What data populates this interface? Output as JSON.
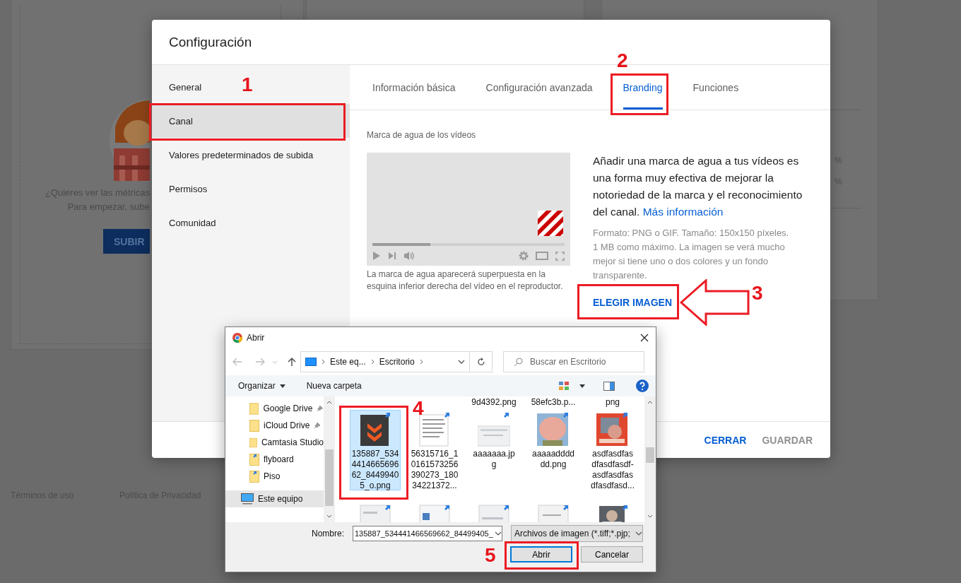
{
  "page": {
    "upload_prompt": [
      "¿Quieres ver las métricas",
      "Para empezar, sube"
    ],
    "upload_button": "SUBIR",
    "stats_percent": [
      "%",
      "%"
    ],
    "footer_links": [
      "Términos de uso",
      "Política de Privacidad"
    ]
  },
  "settings_dialog": {
    "title": "Configuración",
    "sidebar": [
      {
        "label": "General",
        "selected": false
      },
      {
        "label": "Canal",
        "selected": true
      },
      {
        "label": "Valores predeterminados de subida",
        "selected": false
      },
      {
        "label": "Permisos",
        "selected": false
      },
      {
        "label": "Comunidad",
        "selected": false
      }
    ],
    "tabs": [
      {
        "label": "Información básica",
        "selected": false
      },
      {
        "label": "Configuración avanzada",
        "selected": false
      },
      {
        "label": "Branding",
        "selected": true
      },
      {
        "label": "Funciones",
        "selected": false
      }
    ],
    "watermark": {
      "heading": "Marca de agua de los vídeos",
      "preview": {
        "level": 0.3
      },
      "caption": "La marca de agua aparecerá superpuesta en la esquina inferior derecha del vídeo en el reproductor.",
      "description": "Añadir una marca de agua a tus vídeos es una forma muy efectiva de mejorar la notoriedad de la marca y el reconocimiento del canal.",
      "link": "Más información",
      "format_note": "Formato: PNG o GIF. Tamaño: 150x150 píxeles. 1 MB como máximo. La imagen se verá mucho mejor si tiene uno o dos colores y un fondo transparente.",
      "choose_button": "ELEGIR IMAGEN"
    },
    "buttons": [
      {
        "label": "CERRAR",
        "disabled": false
      },
      {
        "label": "GUARDAR",
        "disabled": true
      }
    ]
  },
  "file_dialog": {
    "title": "Abrir",
    "breadcrumb": [
      "Este eq...",
      "Escritorio"
    ],
    "search": {
      "placeholder": "Buscar en Escritorio"
    },
    "toolbar": [
      "Organizar",
      "Nueva carpeta"
    ],
    "nav_items": [
      {
        "label": "Google Drive",
        "kind": "folder",
        "pinned": true,
        "selected": false
      },
      {
        "label": "iCloud Drive",
        "kind": "folder",
        "pinned": true,
        "selected": false
      },
      {
        "label": "Camtasia Studio",
        "kind": "folder",
        "pinned": false,
        "selected": false
      },
      {
        "label": "flyboard",
        "kind": "shortcut",
        "pinned": false,
        "selected": false
      },
      {
        "label": "Piso",
        "kind": "shortcut",
        "pinned": false,
        "selected": false
      },
      {
        "label": "Este equipo",
        "kind": "computer",
        "pinned": false,
        "selected": true
      }
    ],
    "top_row_names": [
      "9d4392.png",
      "58efc3b.p...",
      "png"
    ],
    "files": [
      {
        "name_lines": [
          "135887_534",
          "4414665696",
          "62_8449940",
          "5_o.png"
        ],
        "selected": true
      },
      {
        "name_lines": [
          "56315716_1",
          "0161573256",
          "390273_180",
          "34221372..."
        ],
        "selected": false
      },
      {
        "name_lines": [
          "aaaaaaa.jp",
          "g"
        ],
        "selected": false
      },
      {
        "name_lines": [
          "aaaaadddd",
          "dd.png"
        ],
        "selected": false
      },
      {
        "name_lines": [
          "asdfasdfas",
          "dfasdfasdf-",
          "asdfasdfas",
          "dfasdfasd..."
        ],
        "selected": false
      }
    ],
    "more_files": [
      {
        "kind": "picture"
      },
      {
        "kind": "picture"
      },
      {
        "kind": "picture"
      },
      {
        "kind": "picture"
      },
      {
        "kind": "picture"
      }
    ],
    "name_label": "Nombre:",
    "name_value": "135887_534441466569662_84499405_",
    "file_type": "Archivos de imagen (*.tiff;*.pjp;",
    "buttons": [
      {
        "label": "Abrir",
        "default": true
      },
      {
        "label": "Cancelar",
        "default": false
      }
    ]
  },
  "annotations": [
    {
      "label": "1"
    },
    {
      "label": "2"
    },
    {
      "label": "3"
    },
    {
      "label": "4"
    },
    {
      "label": "5"
    }
  ]
}
